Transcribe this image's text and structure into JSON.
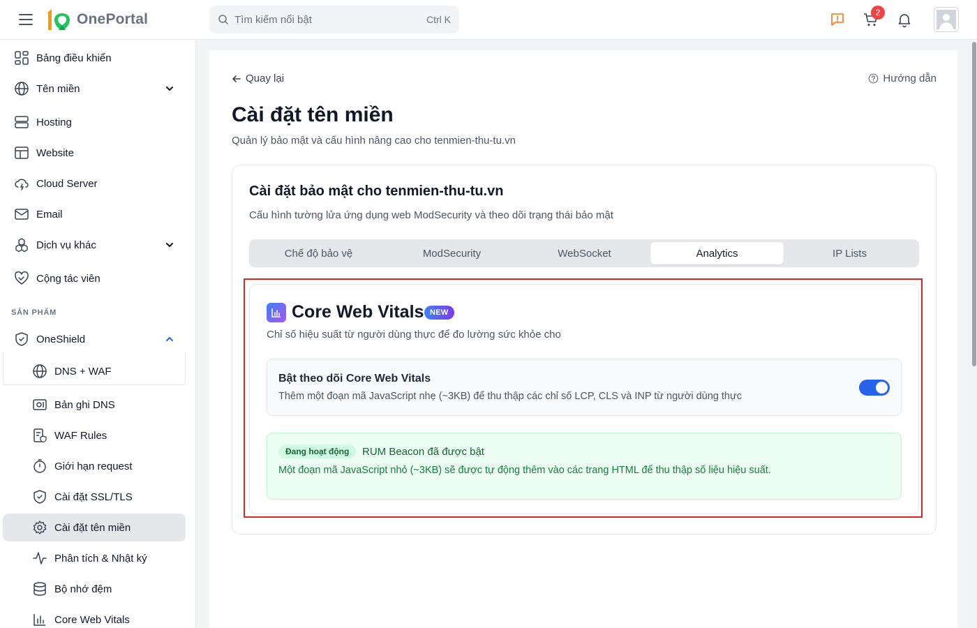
{
  "brand": {
    "name": "OnePortal"
  },
  "search": {
    "placeholder": "Tìm kiếm nổi bật",
    "shortcut": "Ctrl K"
  },
  "header": {
    "cart_count": "2"
  },
  "sidebar": {
    "items": [
      {
        "label": "Bảng điều khiển",
        "icon": "dashboard-icon"
      },
      {
        "label": "Tên miền",
        "icon": "globe-icon"
      },
      {
        "label": "Hosting",
        "icon": "server-icon"
      },
      {
        "label": "Website",
        "icon": "website-icon"
      },
      {
        "label": "Cloud Server",
        "icon": "cloud-icon"
      },
      {
        "label": "Email",
        "icon": "mail-icon"
      },
      {
        "label": "Dịch vụ khác",
        "icon": "boxes-icon"
      },
      {
        "label": "Cộng tác viên",
        "icon": "handshake-icon"
      }
    ],
    "section_label": "SẢN PHẨM",
    "product": {
      "label": "OneShield",
      "icon": "shield-icon"
    },
    "sub_items": [
      {
        "label": "DNS + WAF",
        "icon": "globe-icon"
      },
      {
        "label": "Bản ghi DNS",
        "icon": "dns-record-icon"
      },
      {
        "label": "WAF Rules",
        "icon": "waf-rules-icon"
      },
      {
        "label": "Giới hạn request",
        "icon": "timer-icon"
      },
      {
        "label": "Cài đặt SSL/TLS",
        "icon": "shield-check-icon"
      },
      {
        "label": "Cài đặt tên miền",
        "icon": "gear-icon"
      },
      {
        "label": "Phân tích & Nhật ký",
        "icon": "activity-icon"
      },
      {
        "label": "Bộ nhớ đệm",
        "icon": "database-icon"
      },
      {
        "label": "Core Web Vitals",
        "icon": "bar-chart-icon"
      }
    ]
  },
  "page": {
    "back_label": "Quay lại",
    "guide_label": "Hướng dẫn",
    "title": "Cài đặt tên miền",
    "subtitle": "Quản lý bảo mật và cấu hình nâng cao cho tenmien-thu-tu.vn"
  },
  "security_card": {
    "title": "Cài đặt bảo mật cho tenmien-thu-tu.vn",
    "subtitle": "Cấu hình tường lửa ứng dụng web ModSecurity và theo dõi trạng thái bảo mật",
    "tabs": [
      "Chế độ bảo vệ",
      "ModSecurity",
      "WebSocket",
      "Analytics",
      "IP Lists"
    ],
    "active_tab": "Analytics"
  },
  "cwv": {
    "title": "Core Web Vitals",
    "badge": "NEW",
    "description": "Chỉ số hiệu suất từ người dùng thực để đo lường sức khỏe cho",
    "toggle_title": "Bật theo dõi Core Web Vitals",
    "toggle_desc": "Thêm một đoạn mã JavaScript nhẹ (~3KB) để thu thập các chỉ số LCP, CLS và INP từ người dùng thực",
    "toggle_on": true,
    "status_pill": "Đang hoạt động",
    "status_title": "RUM Beacon đã được bật",
    "status_desc": "Một đoạn mã JavaScript nhỏ (~3KB) sẽ được tự động thêm vào các trang HTML để thu thập số liệu hiệu suất."
  },
  "colors": {
    "accent": "#2563eb",
    "highlight": "#dc2626",
    "success": "#15803d",
    "logo_green": "#22c55e",
    "logo_orange": "#f59e0b"
  }
}
